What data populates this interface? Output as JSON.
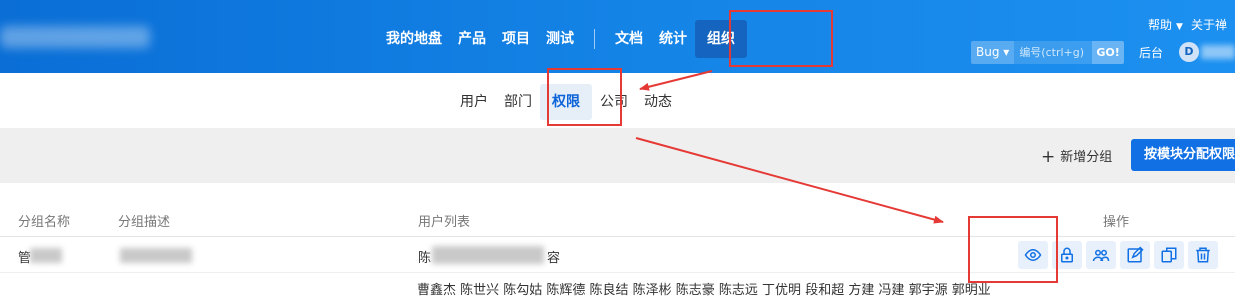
{
  "topbar": {
    "main_nav": [
      "我的地盘",
      "产品",
      "项目",
      "测试"
    ],
    "secondary_nav": [
      "文档",
      "统计"
    ],
    "active_nav": "组织",
    "help_label": "帮助",
    "about_label": "关于禅",
    "search_type": "Bug",
    "search_placeholder": "编号(ctrl+g)",
    "go_label": "GO!",
    "admin_label": "后台",
    "avatar_letter": "D",
    "brand_color": "#0a6ed6"
  },
  "subnav": {
    "items": [
      "用户",
      "部门",
      "权限",
      "公司",
      "动态"
    ],
    "active": "权限"
  },
  "toolbar": {
    "add_group_label": "新增分组",
    "assign_label": "按模块分配权限"
  },
  "table": {
    "headers": {
      "name": "分组名称",
      "desc": "分组描述",
      "users": "用户列表",
      "actions": "操作"
    },
    "rows": [
      {
        "name": "管",
        "users_prefix": "陈",
        "users_suffix": "容"
      },
      {
        "users": "曹鑫杰 陈世兴 陈勾姑 陈辉德 陈良结 陈泽彬 陈志豪 陈志远 丁优明 段和超 方建 冯建 郭宇源 郭明业"
      }
    ],
    "action_icons": [
      "eye-icon",
      "lock-icon",
      "users-icon",
      "edit-icon",
      "copy-icon",
      "trash-icon"
    ]
  },
  "annotation_color": "#e53935"
}
